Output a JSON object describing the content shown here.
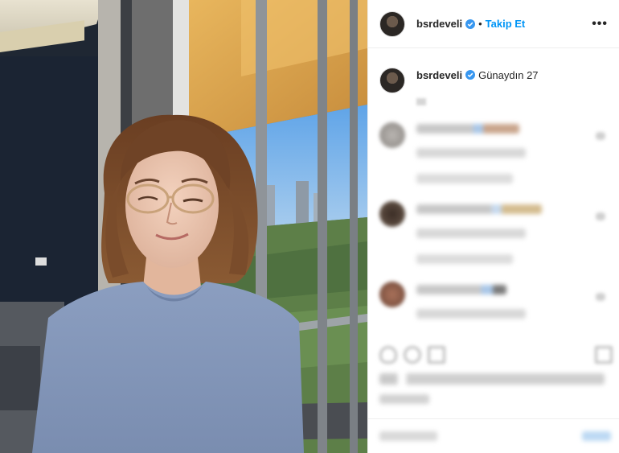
{
  "post": {
    "username": "bsrdeveli",
    "follow_label": "Takip Et",
    "more_label": "•••",
    "caption_text": "Günaydın 27"
  },
  "icons": {
    "verified": "verified-badge-icon",
    "more": "more-options-icon"
  },
  "colors": {
    "accent": "#0095f6",
    "verified": "#3897f0"
  }
}
